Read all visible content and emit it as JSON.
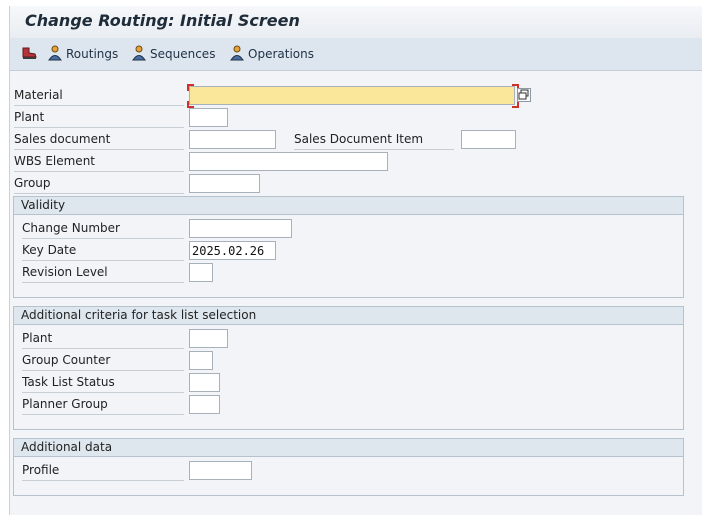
{
  "title": "Change Routing: Initial Screen",
  "toolbar": {
    "routings": "Routings",
    "sequences": "Sequences",
    "operations": "Operations"
  },
  "fields": {
    "material": {
      "label": "Material",
      "value": ""
    },
    "plant": {
      "label": "Plant",
      "value": ""
    },
    "sales_document": {
      "label": "Sales document",
      "value": ""
    },
    "sales_document_item": {
      "label": "Sales Document Item",
      "value": ""
    },
    "wbs_element": {
      "label": "WBS Element",
      "value": ""
    },
    "group": {
      "label": "Group",
      "value": ""
    }
  },
  "validity": {
    "title": "Validity",
    "change_number": {
      "label": "Change Number",
      "value": ""
    },
    "key_date": {
      "label": "Key Date",
      "value": "2025.02.26"
    },
    "revision_level": {
      "label": "Revision Level",
      "value": ""
    }
  },
  "criteria": {
    "title": "Additional criteria for task list selection",
    "plant": {
      "label": "Plant",
      "value": ""
    },
    "group_counter": {
      "label": "Group Counter",
      "value": ""
    },
    "task_list_status": {
      "label": "Task List Status",
      "value": ""
    },
    "planner_group": {
      "label": "Planner Group",
      "value": ""
    }
  },
  "additional": {
    "title": "Additional data",
    "profile": {
      "label": "Profile",
      "value": ""
    }
  },
  "colors": {
    "required_field": "#fbe79a",
    "toolbar_bg": "#dde6ee",
    "group_header_bg": "#dfe7ee",
    "required_marker": "#d0302a"
  }
}
